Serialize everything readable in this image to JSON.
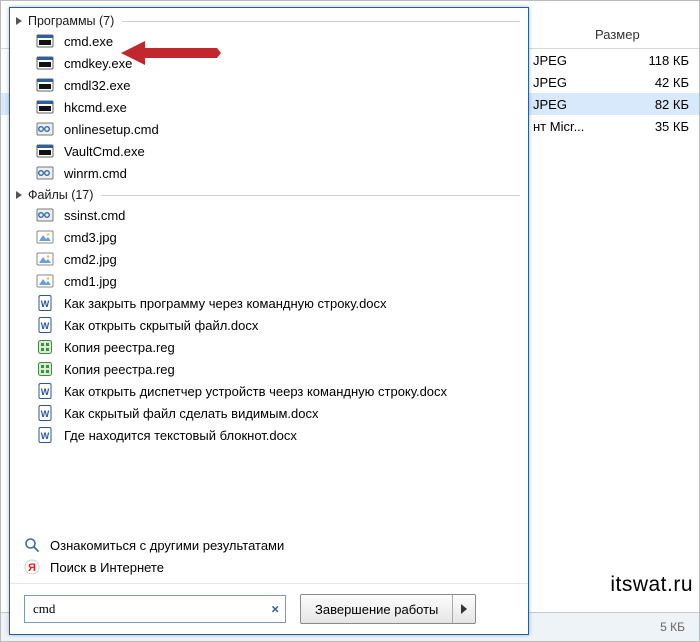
{
  "explorer": {
    "size_header": "Размер",
    "rows": [
      {
        "type": "JPEG",
        "size": "118 КБ"
      },
      {
        "type": "JPEG",
        "size": "42 КБ"
      },
      {
        "type": "JPEG",
        "size": "82 КБ",
        "selected": true
      },
      {
        "type": "нт Micr...",
        "size": "35 КБ"
      }
    ],
    "footer_size": "5 КБ"
  },
  "watermark": "itswat.ru",
  "panel": {
    "groups": [
      {
        "title": "Программы (7)",
        "items": [
          {
            "icon": "exe",
            "label": "cmd.exe"
          },
          {
            "icon": "exe",
            "label": "cmdkey.exe"
          },
          {
            "icon": "exe",
            "label": "cmdl32.exe"
          },
          {
            "icon": "exe",
            "label": "hkcmd.exe"
          },
          {
            "icon": "cmd",
            "label": "onlinesetup.cmd"
          },
          {
            "icon": "exe",
            "label": "VaultCmd.exe"
          },
          {
            "icon": "cmd",
            "label": "winrm.cmd"
          }
        ]
      },
      {
        "title": "Файлы (17)",
        "items": [
          {
            "icon": "cmd",
            "label": "ssinst.cmd"
          },
          {
            "icon": "img",
            "label": "cmd3.jpg"
          },
          {
            "icon": "img",
            "label": "cmd2.jpg"
          },
          {
            "icon": "img",
            "label": "cmd1.jpg"
          },
          {
            "icon": "doc",
            "label": "Как закрыть программу через командную строку.docx"
          },
          {
            "icon": "doc",
            "label": "Как открыть скрытый файл.docx"
          },
          {
            "icon": "reg",
            "label": "Копия реестра.reg"
          },
          {
            "icon": "reg",
            "label": "Копия реестра.reg"
          },
          {
            "icon": "doc",
            "label": "Как открыть диспетчер устройств чеерз командную строку.docx"
          },
          {
            "icon": "doc",
            "label": "Как скрытый файл сделать видимым.docx"
          },
          {
            "icon": "doc",
            "label": "Где находится текстовый блокнот.docx"
          }
        ]
      }
    ],
    "more_results": "Ознакомиться с другими результатами",
    "web_search": "Поиск в Интернете",
    "search_value": "cmd",
    "search_placeholder": "",
    "clear_symbol": "×",
    "shutdown_label": "Завершение работы"
  }
}
